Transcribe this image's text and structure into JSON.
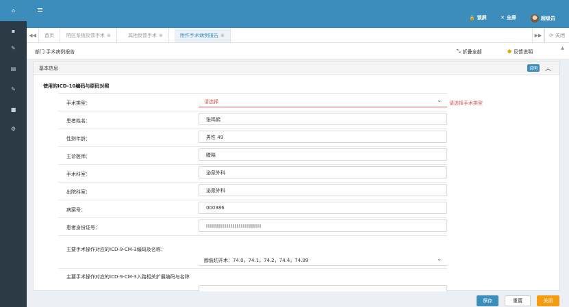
{
  "header": {
    "menu_icon": "hamburger-icon",
    "lock_label": "锁屏",
    "fullscreen_label": "全屏",
    "user_name": "超级员"
  },
  "tabs": {
    "items": [
      {
        "label": "首页",
        "closable": false
      },
      {
        "label": "院区系统反馈手术",
        "closable": true
      },
      {
        "label": "其他反馈手术",
        "closable": true
      },
      {
        "label": "附件手术病例报告",
        "closable": true,
        "active": true
      }
    ],
    "close_ops_label": "关闭"
  },
  "toolbar": {
    "breadcrumb": "部门 手术病例报告",
    "collapse_label": "折叠全部",
    "feedback_label": "反馈说明"
  },
  "panel": {
    "title": "基本信息",
    "badge": "说明",
    "subtitle": "使用的ICD-10编码与原码对照"
  },
  "form": {
    "rows": [
      {
        "label": "手术类型：",
        "value": "请选择",
        "error": "请选择手术类型"
      },
      {
        "label": "患者姓名：",
        "value": "张鸣鹤"
      },
      {
        "label": "性别年龄：",
        "value": "男性 49"
      },
      {
        "label": "主诊医师：",
        "value": "滕晓"
      },
      {
        "label": "手术科室：",
        "value": "泌尿外科"
      },
      {
        "label": "出院科室：",
        "value": "泌尿外科"
      },
      {
        "label": "病案号：",
        "value": "000386"
      },
      {
        "label": "患者身份证号：",
        "value": ""
      },
      {
        "label": "主要手术操作对应的ICD-9-CM-3编码及名称：",
        "value": "膀胱切开术：74.0，74.1，74.2，74.4，74.99"
      },
      {
        "label": "主要手术操作对应的ICD-9-CM-3入路相关扩展编码与名称",
        "value": ""
      }
    ]
  },
  "buttons": {
    "save": "保存",
    "reset": "重置",
    "close": "关闭"
  },
  "colors": {
    "primary": "#3c8dbc",
    "sidebar": "#2b3a45",
    "error": "#d9534f",
    "warn": "#f39c12"
  }
}
